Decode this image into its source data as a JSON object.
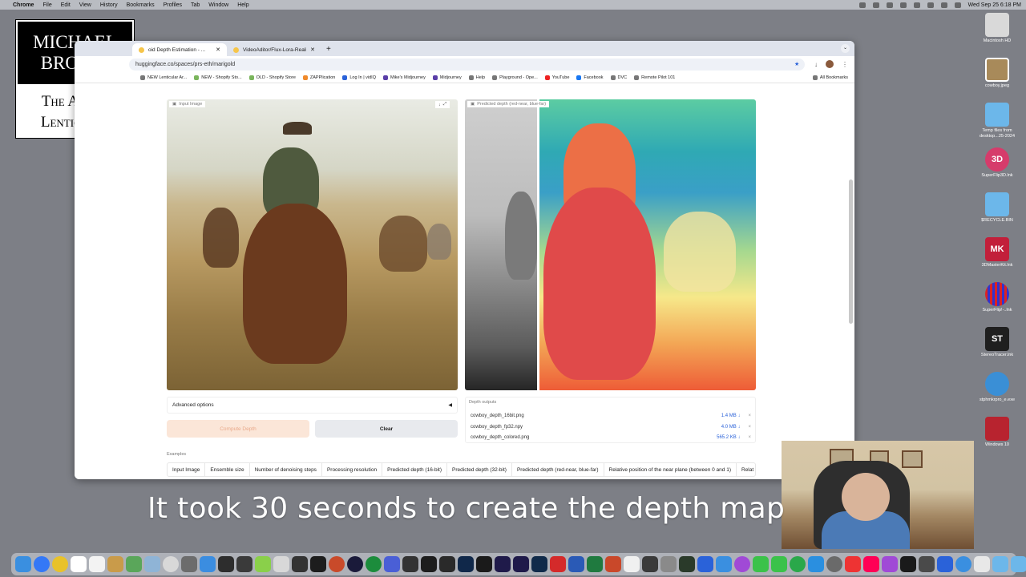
{
  "menubar": {
    "app": "Chrome",
    "items": [
      "File",
      "Edit",
      "View",
      "History",
      "Bookmarks",
      "Profiles",
      "Tab",
      "Window",
      "Help"
    ],
    "clock": "Wed Sep 25  6:18 PM"
  },
  "logo": {
    "line1": "MICHAEL",
    "line2": "BROWN",
    "line3": "The Art of",
    "line4": "Lenticular"
  },
  "browser": {
    "tabs": [
      {
        "title": "oid Depth Estimation - ..."
      },
      {
        "title": "VideoAditor/Flux-Lora-Realis..."
      }
    ],
    "url": "huggingface.co/spaces/prs-eth/marigold",
    "bookmarks": [
      "NEW Lenticular Ar...",
      "NEW - Shopify Sto...",
      "OLD - Shopify Store",
      "ZAPPlication",
      "Log In | vidIQ",
      "Mike's Midjourney",
      "Midjourney",
      "Help",
      "Playground - Ope...",
      "YouTube",
      "Facebook",
      "DVC",
      "Remote Pilot 101"
    ],
    "all_bookmarks": "All Bookmarks"
  },
  "app": {
    "input_label": "Input Image",
    "depth_label": "Predicted depth (red-near, blue-far)",
    "advanced": "Advanced options",
    "compute": "Compute Depth",
    "clear": "Clear",
    "outputs_label": "Depth outputs",
    "outputs": [
      {
        "name": "cowboy_depth_16bit.png",
        "size": "1.4 MB ↓"
      },
      {
        "name": "cowboy_depth_fp32.npy",
        "size": "4.0 MB ↓"
      },
      {
        "name": "cowboy_depth_colored.png",
        "size": "565.2 KB ↓"
      }
    ],
    "examples_label": "Examples",
    "example_headers": [
      "Input Image",
      "Ensemble size",
      "Number of denoising steps",
      "Processing resolution",
      "Predicted depth (16-bit)",
      "Predicted depth (32-bit)",
      "Predicted depth (red-near, blue-far)",
      "Relative position of the near plane (between 0 and 1)",
      "Relat"
    ]
  },
  "desktop": [
    {
      "label": "Macintosh HD"
    },
    {
      "label": "cowboy.jpeg"
    },
    {
      "label": "Temp files from desktop...25-2024"
    },
    {
      "label": "SuperFlip3D.lnk"
    },
    {
      "label": "$RECYCLE.BIN"
    },
    {
      "label": "3DMasterKit.lnk"
    },
    {
      "label": "SuperFlip!-..lnk"
    },
    {
      "label": "StereoTracer.lnk"
    },
    {
      "label": "stphmkrpro_e.exe"
    },
    {
      "label": "Windows 10"
    }
  ],
  "caption": "It took 30 seconds to create the depth map",
  "colors": {
    "accent": "#2a62d9",
    "compute_bg": "#fbe6d8",
    "compute_text": "#e9a98a"
  }
}
